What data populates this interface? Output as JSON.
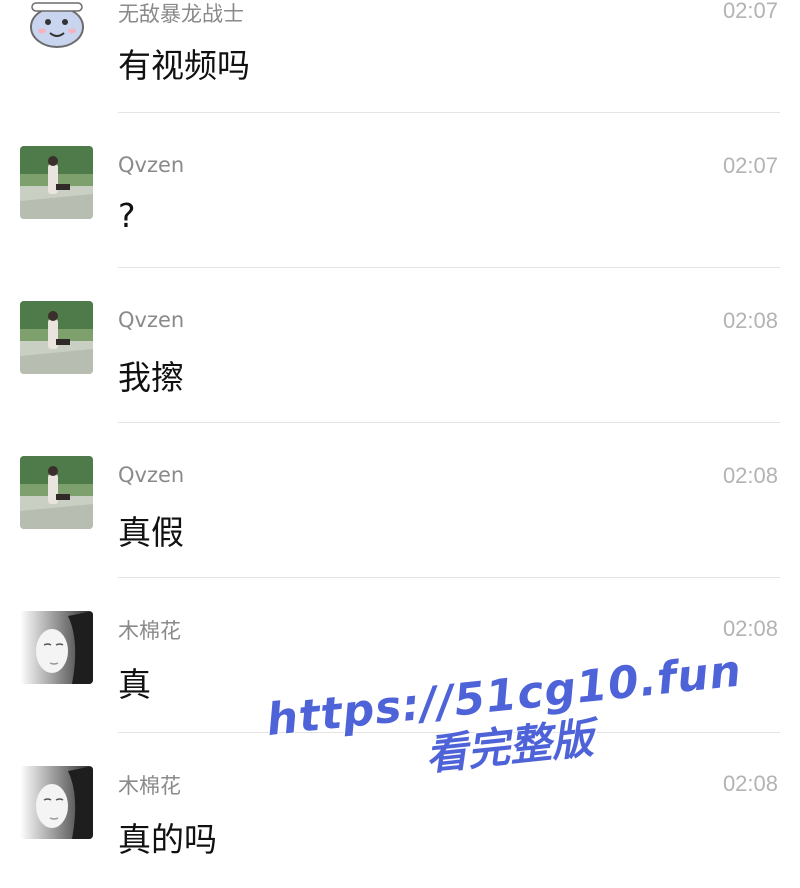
{
  "messages": [
    {
      "sender": "无敌暴龙战士",
      "time": "02:07",
      "text": "有视频吗",
      "avatar_icon": "cartoon-dinosaur-avatar"
    },
    {
      "sender": "Qvzen",
      "time": "02:07",
      "text": "?",
      "avatar_icon": "garden-photo-avatar"
    },
    {
      "sender": "Qvzen",
      "time": "02:08",
      "text": "我擦",
      "avatar_icon": "garden-photo-avatar"
    },
    {
      "sender": "Qvzen",
      "time": "02:08",
      "text": "真假",
      "avatar_icon": "garden-photo-avatar"
    },
    {
      "sender": "木棉花",
      "time": "02:08",
      "text": "真",
      "avatar_icon": "woman-portrait-avatar"
    },
    {
      "sender": "木棉花",
      "time": "02:08",
      "text": "真的吗",
      "avatar_icon": "woman-portrait-avatar"
    }
  ],
  "watermark": {
    "url": "https://51cg10.fun",
    "subtitle": "看完整版",
    "color": "#4f63d8"
  }
}
